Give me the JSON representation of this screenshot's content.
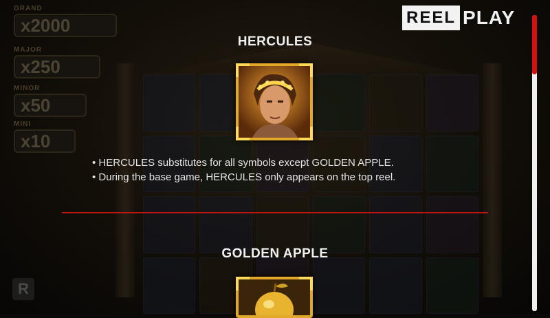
{
  "brand": {
    "reel": "REEL",
    "play": "PLAY"
  },
  "jackpots": [
    {
      "label": "GRAND",
      "value": "x2000"
    },
    {
      "label": "MAJOR",
      "value": "x250"
    },
    {
      "label": "MINOR",
      "value": "x50"
    },
    {
      "label": "MINI",
      "value": "x10"
    }
  ],
  "symbols": {
    "hercules": {
      "title": "HERCULES",
      "icon": "hercules-portrait-icon",
      "rules": [
        "• HERCULES substitutes for all symbols except GOLDEN APPLE.",
        "• During the base game, HERCULES only appears on the top reel."
      ]
    },
    "golden_apple": {
      "title": "GOLDEN APPLE",
      "icon": "golden-apple-icon"
    }
  },
  "colors": {
    "accent_red": "#c01616",
    "gold": "#e2a82a",
    "text": "#f0f0f0"
  },
  "scroll": {
    "position": 0.0
  }
}
